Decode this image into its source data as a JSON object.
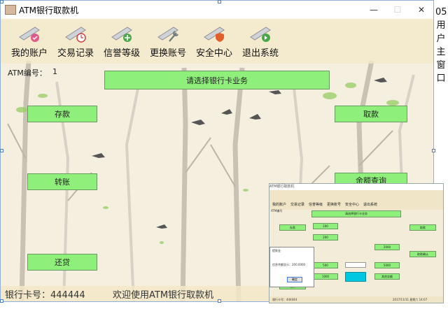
{
  "window": {
    "title": "ATM银行取款机",
    "min_label": "—",
    "max_label": "☐",
    "close_label": "✕"
  },
  "menu": {
    "items": [
      {
        "label": "我的账户",
        "icon": "account-icon"
      },
      {
        "label": "交易记录",
        "icon": "clock-icon"
      },
      {
        "label": "信誉等级",
        "icon": "plus-icon"
      },
      {
        "label": "更换账号",
        "icon": "wrench-icon"
      },
      {
        "label": "安全中心",
        "icon": "shield-icon"
      },
      {
        "label": "退出系统",
        "icon": "arrow-right-icon"
      }
    ]
  },
  "info": {
    "atm_label": "ATM编号：",
    "atm_value": "1"
  },
  "main": {
    "prompt": "请选择银行卡业务",
    "deposit": "存款",
    "transfer": "转账",
    "repay": "还贷",
    "withdraw": "取款",
    "balance": "余额查询"
  },
  "status": {
    "card": "银行卡号：444444",
    "welcome": "欢迎使用ATM银行取款机"
  },
  "side_text": "05用户主窗口",
  "inset": {
    "title": "ATM银行取款机",
    "menu": [
      "我的账户",
      "交易记录",
      "信誉等级",
      "更换账号",
      "安全中心",
      "退出系统"
    ],
    "atm_label": "ATM编号",
    "prompt": "请选择银行卡业务",
    "deposit": "存款",
    "withdraw": "取款",
    "transfer": "转账",
    "repay": "还贷",
    "confirm": "取款确认",
    "amount_labels": [
      "100",
      "200",
      "500",
      "1000",
      "2000",
      "5000"
    ],
    "other_amount": "其他金额",
    "dialog_title": "提款金",
    "dialog_msg": "信息余额显示：200.0000",
    "dialog_ok": "确定",
    "status_card": "银行卡号：444444",
    "status_time": "2017/11/11 星期六 14:07"
  },
  "colors": {
    "button_green": "#8ef07a",
    "cyan_button": "#00c8e0",
    "background": "#f4efdf"
  }
}
